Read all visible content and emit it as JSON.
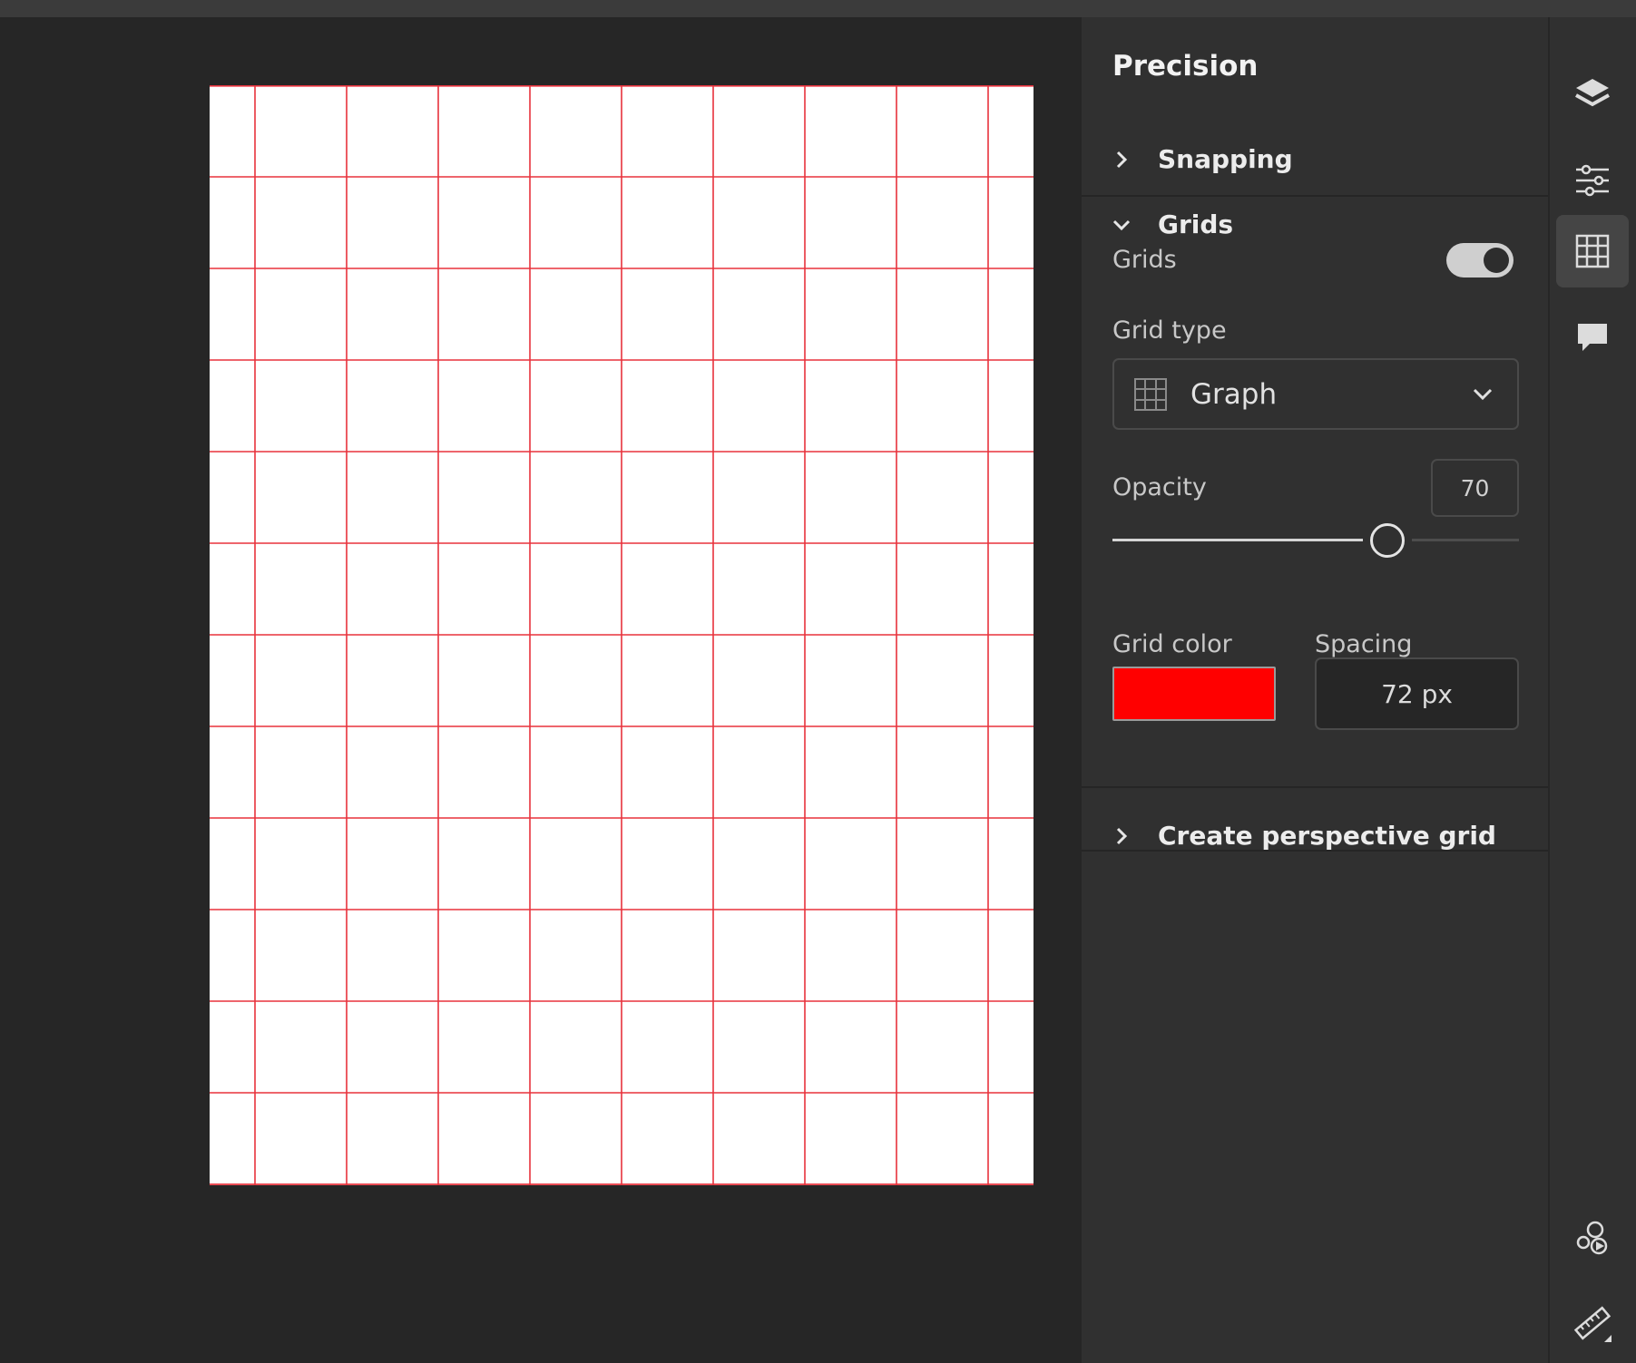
{
  "panel": {
    "title": "Precision",
    "snapping": {
      "label": "Snapping",
      "expanded": false
    },
    "grids_section": {
      "label": "Grids",
      "expanded": true,
      "toggle_label": "Grids",
      "toggle_on": true,
      "grid_type_label": "Grid type",
      "grid_type_value": "Graph",
      "opacity_label": "Opacity",
      "opacity_value": "70",
      "opacity_fraction": 0.7,
      "grid_color_label": "Grid color",
      "grid_color": "#ff0000",
      "spacing_label": "Spacing",
      "spacing_value": "72 px"
    },
    "perspective": {
      "label": "Create perspective grid",
      "expanded": false
    }
  },
  "rail": {
    "items": [
      {
        "name": "layers-icon",
        "active": false
      },
      {
        "name": "adjustments-icon",
        "active": false
      },
      {
        "name": "grid-icon",
        "active": true
      },
      {
        "name": "comment-icon",
        "active": false
      },
      {
        "name": "livestream-icon",
        "active": false
      },
      {
        "name": "ruler-icon",
        "active": false
      }
    ]
  },
  "canvas": {
    "grid_line_color": "#e8323c",
    "grid_columns": 9,
    "grid_rows": 12
  }
}
